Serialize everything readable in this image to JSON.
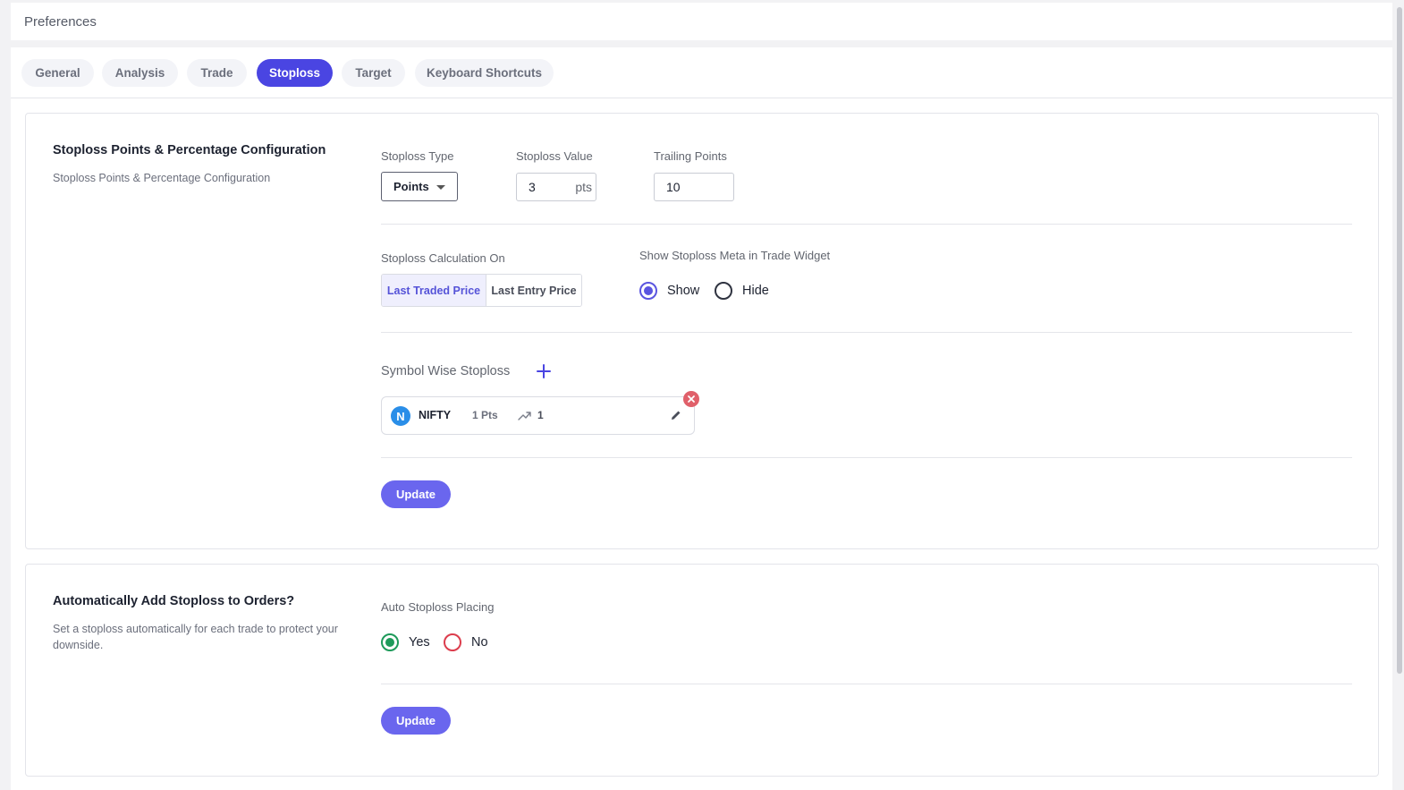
{
  "header": {
    "title": "Preferences"
  },
  "tabs": [
    {
      "label": "General"
    },
    {
      "label": "Analysis"
    },
    {
      "label": "Trade"
    },
    {
      "label": "Stoploss",
      "active": true
    },
    {
      "label": "Target"
    },
    {
      "label": "Keyboard Shortcuts"
    }
  ],
  "section1": {
    "title": "Stoploss Points & Percentage Configuration",
    "description": "Stoploss Points & Percentage Configuration",
    "stoploss_type": {
      "label": "Stoploss Type",
      "value": "Points"
    },
    "stoploss_value": {
      "label": "Stoploss Value",
      "value": "3",
      "unit": "pts"
    },
    "trailing_points": {
      "label": "Trailing Points",
      "value": "10"
    },
    "calculation_on": {
      "label": "Stoploss Calculation On",
      "options": [
        "Last Traded Price",
        "Last Entry Price"
      ],
      "selected": "Last Traded Price"
    },
    "show_meta": {
      "label": "Show Stoploss Meta in Trade Widget",
      "options": [
        "Show",
        "Hide"
      ],
      "selected": "Show"
    },
    "symbol_wise": {
      "label": "Symbol Wise Stoploss",
      "items": [
        {
          "avatar": "N",
          "symbol": "NIFTY",
          "points": "1 Pts",
          "trailing": "1"
        }
      ]
    },
    "update_label": "Update"
  },
  "section2": {
    "title": "Automatically Add Stoploss to Orders?",
    "description": "Set a stoploss automatically for each trade to protect your downside.",
    "auto_placing": {
      "label": "Auto Stoploss Placing",
      "options": [
        "Yes",
        "No"
      ],
      "selected": "Yes"
    },
    "update_label": "Update"
  },
  "colors": {
    "accent": "#4a45e2",
    "button": "#6a66ee",
    "success": "#1e9a5a",
    "danger": "#dc3d4d",
    "avatar": "#2a8ee8"
  }
}
